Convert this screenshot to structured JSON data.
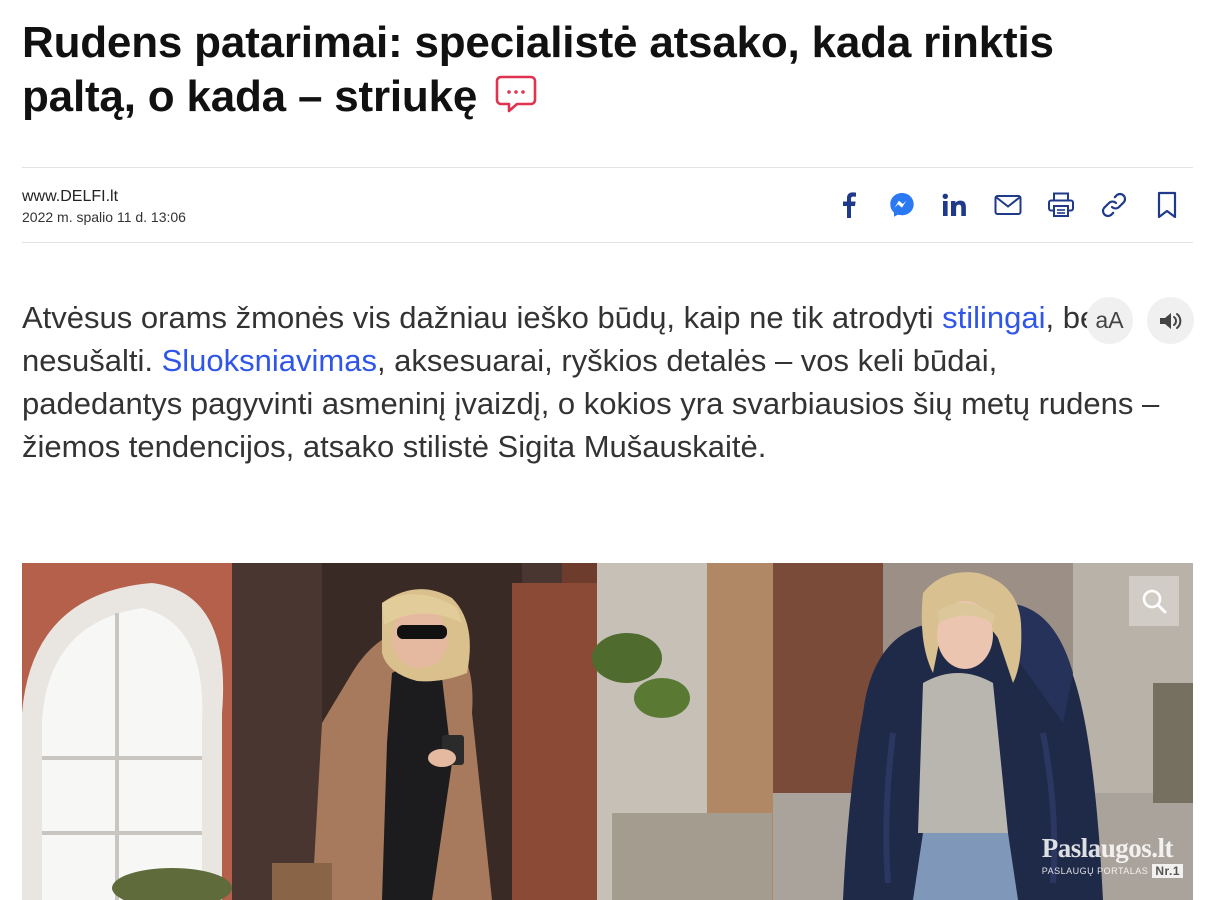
{
  "article": {
    "title": "Rudens patarimai: specialistė atsako, kada rinktis paltą, o kada – striukę",
    "source": "www.DELFI.lt",
    "date": "2022 m. spalio 11 d. 13:06"
  },
  "share": {
    "icons": [
      "facebook-icon",
      "messenger-icon",
      "linkedin-icon",
      "email-icon",
      "print-icon",
      "link-icon",
      "bookmark-icon"
    ]
  },
  "lead": {
    "part1": "Atvėsus orams žmonės vis dažniau ieško būdų, kaip ne tik atrodyti ",
    "link1": "stilingai",
    "part2": ", bet ir nesušalti. ",
    "link2": "Sluoksniavimas",
    "part3": ", aksesuarai, ryškios detalės – vos keli būdai, padedantys pagyvinti asmeninį įvaizdį, o kokios yra svarbiausios šių metų rudens – žiemos tendencijos, atsako stilistė Sigita Mušauskaitė."
  },
  "tools": {
    "font_size_label": "aA"
  },
  "image": {
    "watermark_logo": "Paslaugos.lt",
    "watermark_sub": "PASLAUGŲ PORTALAS",
    "watermark_badge": "Nr.1"
  },
  "colors": {
    "link": "#2f56e8",
    "comment_icon": "#e0334f",
    "share_icons": "#1f3a8a",
    "messenger": "#2a79f2"
  }
}
